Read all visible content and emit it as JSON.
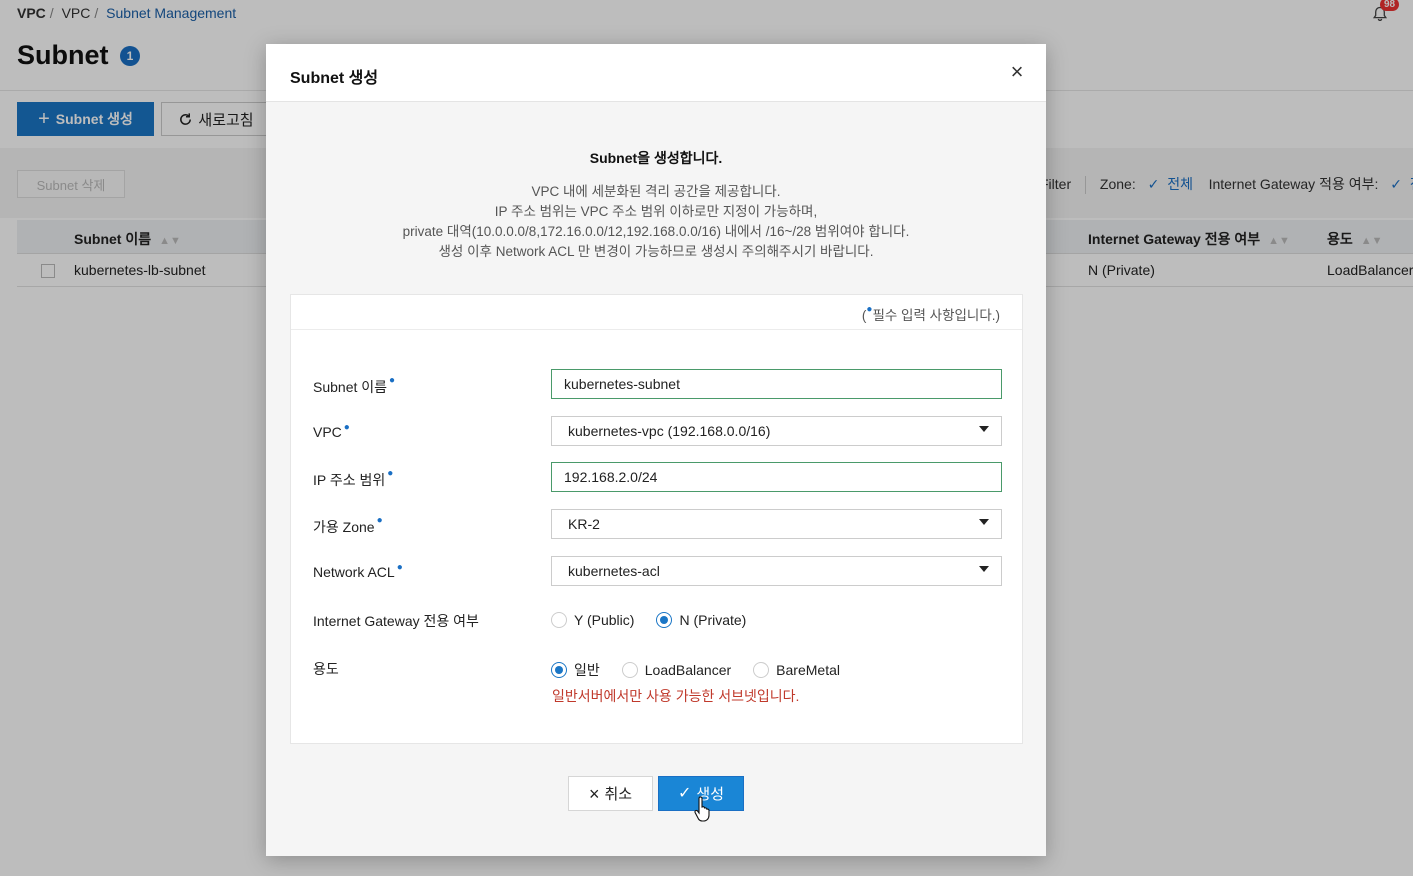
{
  "breadcrumb": [
    "VPC",
    "VPC",
    "Subnet Management"
  ],
  "notifications": {
    "count": "98"
  },
  "page": {
    "title": "Subnet",
    "count": "1"
  },
  "toolbar": {
    "create_label": "Subnet 생성",
    "refresh_label": "새로고침",
    "delete_label": "Subnet 삭제"
  },
  "filter": {
    "label": "Filter",
    "zone_label": "Zone:",
    "zone_value": "전체",
    "igw_label": "Internet Gateway 적용 여부:",
    "igw_value": "전"
  },
  "table": {
    "columns": [
      "Subnet 이름",
      "Internet Gateway 전용 여부",
      "용도"
    ],
    "rows": [
      {
        "name": "kubernetes-lb-subnet",
        "igw": "N (Private)",
        "usage": "LoadBalancer"
      }
    ]
  },
  "modal": {
    "title": "Subnet 생성",
    "intro_heading": "Subnet을 생성합니다.",
    "intro_lines": [
      "VPC 내에 세분화된 격리 공간을 제공합니다.",
      "IP 주소 범위는 VPC 주소 범위 이하로만 지정이 가능하며,",
      "private 대역(10.0.0.0/8,172.16.0.0/12,192.168.0.0/16) 내에서 /16~/28 범위여야 합니다.",
      "생성 이후 Network ACL 만 변경이 가능하므로 생성시 주의해주시기 바랍니다."
    ],
    "required_note_prefix": "(",
    "required_note_text": "필수 입력 사항입니다.)",
    "fields": {
      "subnet_name": {
        "label": "Subnet 이름",
        "value": "kubernetes-subnet"
      },
      "vpc": {
        "label": "VPC",
        "value": "kubernetes-vpc (192.168.0.0/16)"
      },
      "ip_range": {
        "label": "IP 주소 범위",
        "value": "192.168.2.0/24"
      },
      "zone": {
        "label": "가용 Zone",
        "value": "KR-2"
      },
      "network_acl": {
        "label": "Network ACL",
        "value": "kubernetes-acl"
      },
      "igw": {
        "label": "Internet Gateway 전용 여부",
        "options": [
          "Y (Public)",
          "N (Private)"
        ],
        "selected": "N (Private)"
      },
      "usage": {
        "label": "용도",
        "options": [
          "일반",
          "LoadBalancer",
          "BareMetal"
        ],
        "selected": "일반",
        "hint": "일반서버에서만 사용 가능한 서브넷입니다."
      }
    },
    "cancel_label": "취소",
    "submit_label": "생성"
  },
  "colors": {
    "accent": "#1a76c6",
    "hint": "#c0392b",
    "input_focus": "#4a9a6a"
  }
}
